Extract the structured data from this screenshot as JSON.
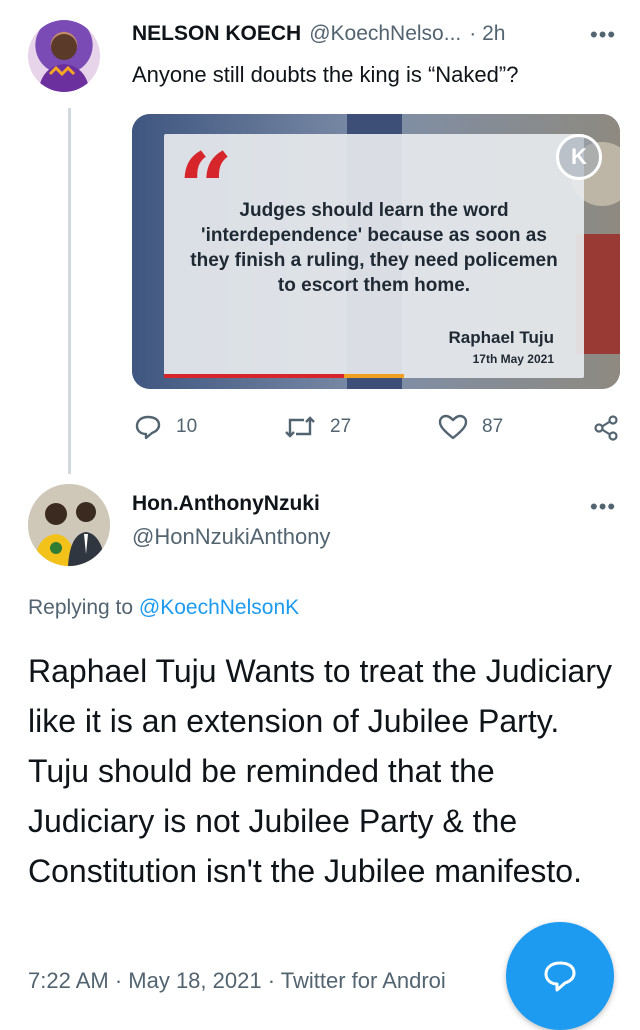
{
  "original_tweet": {
    "author_name": "NELSON KOECH",
    "author_handle": "@KoechNelso...",
    "time": "· 2h",
    "more": "•••",
    "text": "Anyone still doubts the king is “Naked”?",
    "image": {
      "quote_text": "Judges should learn the word 'interdependence' because as soon as they finish a ruling, they need policemen to escort them home.",
      "attribution": "Raphael Tuju",
      "date": "17th May 2021",
      "logo_letter": "K"
    },
    "actions": {
      "replies": "10",
      "retweets": "27",
      "likes": "87"
    }
  },
  "reply_tweet": {
    "author_name": "Hon.AnthonyNzuki",
    "author_handle": "@HonNzukiAnthony",
    "more": "•••",
    "replying_prefix": "Replying to ",
    "replying_handle": "@KoechNelsonK",
    "text": "Raphael Tuju Wants to treat the Judiciary like it is an extension of Jubilee Party. Tuju should be reminded that the Judiciary is not Jubilee  Party & the Constitution isn't the Jubilee manifesto.",
    "meta": "7:22 AM · May 18, 2021 · Twitter for Androi"
  },
  "colors": {
    "accent": "#1d9bf0",
    "muted": "#536471",
    "quote_red": "#d6262b"
  },
  "icons": [
    "reply-icon",
    "retweet-icon",
    "like-icon",
    "share-icon",
    "compose-reply-icon",
    "more-icon"
  ]
}
